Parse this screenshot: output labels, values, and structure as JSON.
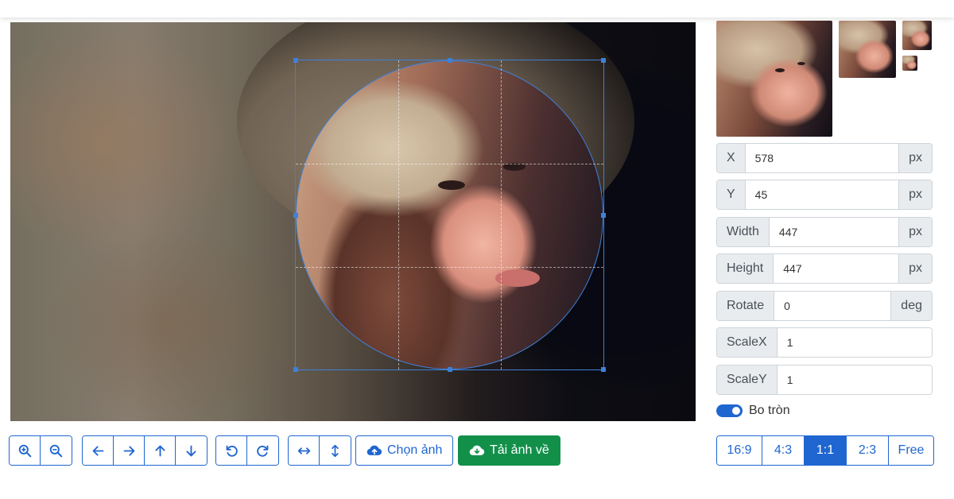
{
  "toolbar": {
    "zoom_in_icon": "zoom-in-icon",
    "zoom_out_icon": "zoom-out-icon",
    "choose_image_label": "Chọn ảnh",
    "download_label": "Tải ảnh về"
  },
  "fields": {
    "x": {
      "label": "X",
      "value": "578",
      "unit": "px"
    },
    "y": {
      "label": "Y",
      "value": "45",
      "unit": "px"
    },
    "width": {
      "label": "Width",
      "value": "447",
      "unit": "px"
    },
    "height": {
      "label": "Height",
      "value": "447",
      "unit": "px"
    },
    "rotate": {
      "label": "Rotate",
      "value": "0",
      "unit": "deg"
    },
    "scale_x": {
      "label": "ScaleX",
      "value": "1"
    },
    "scale_y": {
      "label": "ScaleY",
      "value": "1"
    }
  },
  "toggle": {
    "label": "Bo tròn",
    "on": true
  },
  "ratios": [
    "16:9",
    "4:3",
    "1:1",
    "2:3",
    "Free"
  ],
  "active_ratio": "1:1",
  "colors": {
    "primary": "#1f66d1",
    "success": "#12904a",
    "crop_border": "#3f80d8"
  }
}
